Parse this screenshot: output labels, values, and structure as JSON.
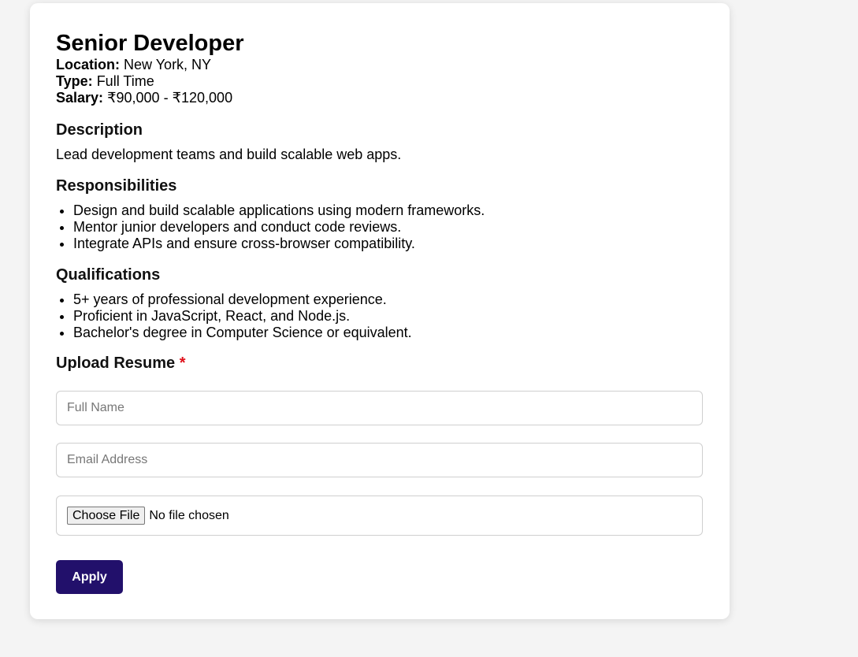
{
  "job": {
    "title": "Senior Developer",
    "location_label": "Location:",
    "location": "New York, NY",
    "type_label": "Type:",
    "type": "Full Time",
    "salary_label": "Salary:",
    "salary": "₹90,000 - ₹120,000"
  },
  "description": {
    "heading": "Description",
    "text": "Lead development teams and build scalable web apps."
  },
  "responsibilities": {
    "heading": "Responsibilities",
    "items": [
      "Design and build scalable applications using modern frameworks.",
      "Mentor junior developers and conduct code reviews.",
      "Integrate APIs and ensure cross-browser compatibility."
    ]
  },
  "qualifications": {
    "heading": "Qualifications",
    "items": [
      "5+ years of professional development experience.",
      "Proficient in JavaScript, React, and Node.js.",
      "Bachelor's degree in Computer Science or equivalent."
    ]
  },
  "upload": {
    "heading": "Upload Resume",
    "required_marker": "*",
    "full_name_placeholder": "Full Name",
    "email_placeholder": "Email Address",
    "file_button_label": "Choose File",
    "file_status": "No file chosen",
    "apply_label": "Apply"
  },
  "colors": {
    "accent": "#22106b",
    "required": "#e0101a",
    "background": "#f4f4f4"
  }
}
